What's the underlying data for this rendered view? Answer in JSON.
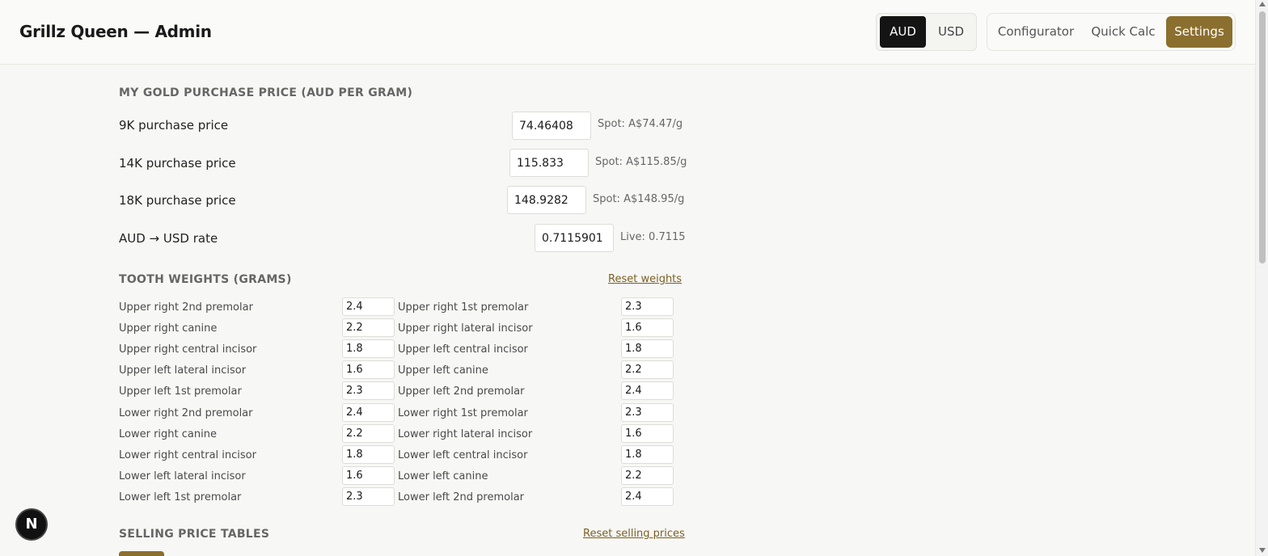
{
  "header": {
    "title": "Grillz Queen — Admin",
    "currency": {
      "options": [
        "AUD",
        "USD"
      ],
      "selected": "AUD"
    },
    "nav": {
      "configurator": "Configurator",
      "quick_calc": "Quick Calc",
      "settings": "Settings",
      "active": "Settings"
    }
  },
  "gold": {
    "title": "MY GOLD PURCHASE PRICE (AUD PER GRAM)",
    "rows": [
      {
        "label": "9K purchase price",
        "value": "74.46408",
        "hint": "Spot: A$74.47/g"
      },
      {
        "label": "14K purchase price",
        "value": "115.833",
        "hint": "Spot: A$115.85/g"
      },
      {
        "label": "18K purchase price",
        "value": "148.9282",
        "hint": "Spot: A$148.95/g"
      },
      {
        "label": "AUD → USD rate",
        "value": "0.7115901",
        "hint": "Live: 0.7115"
      }
    ]
  },
  "weights": {
    "title": "TOOTH WEIGHTS (GRAMS)",
    "reset": "Reset weights",
    "rows": [
      {
        "left_label": "Upper right 2nd premolar",
        "left_value": "2.4",
        "right_label": "Upper right 1st premolar",
        "right_value": "2.3"
      },
      {
        "left_label": "Upper right canine",
        "left_value": "2.2",
        "right_label": "Upper right lateral incisor",
        "right_value": "1.6"
      },
      {
        "left_label": "Upper right central incisor",
        "left_value": "1.8",
        "right_label": "Upper left central incisor",
        "right_value": "1.8"
      },
      {
        "left_label": "Upper left lateral incisor",
        "left_value": "1.6",
        "right_label": "Upper left canine",
        "right_value": "2.2"
      },
      {
        "left_label": "Upper left 1st premolar",
        "left_value": "2.3",
        "right_label": "Upper left 2nd premolar",
        "right_value": "2.4"
      },
      {
        "left_label": "Lower right 2nd premolar",
        "left_value": "2.4",
        "right_label": "Lower right 1st premolar",
        "right_value": "2.3"
      },
      {
        "left_label": "Lower right canine",
        "left_value": "2.2",
        "right_label": "Lower right lateral incisor",
        "right_value": "1.6"
      },
      {
        "left_label": "Lower right central incisor",
        "left_value": "1.8",
        "right_label": "Lower left central incisor",
        "right_value": "1.8"
      },
      {
        "left_label": "Lower left lateral incisor",
        "left_value": "1.6",
        "right_label": "Lower left canine",
        "right_value": "2.2"
      },
      {
        "left_label": "Lower left 1st premolar",
        "left_value": "2.3",
        "right_label": "Lower left 2nd premolar",
        "right_value": "2.4"
      }
    ]
  },
  "selling": {
    "title": "SELLING PRICE TABLES",
    "reset": "Reset selling prices"
  },
  "badge": {
    "letter": "N"
  },
  "colors": {
    "accent": "#8b6f2f",
    "dark": "#141414",
    "background": "#f7f7f5"
  }
}
